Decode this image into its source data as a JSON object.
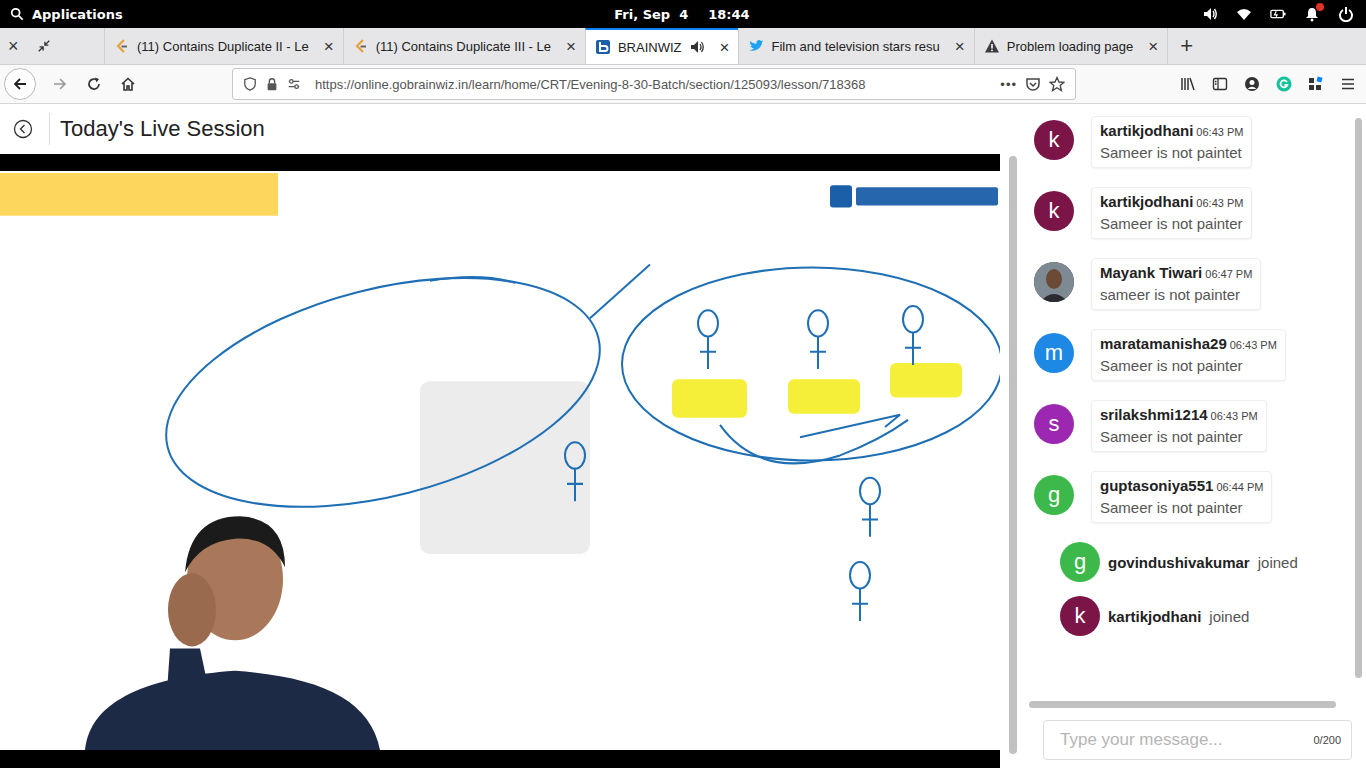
{
  "topbar": {
    "menu": "Applications",
    "date": "Fri, Sep  4",
    "time": "18:44",
    "notification": true
  },
  "window_controls": {
    "close": "×"
  },
  "tabs": [
    {
      "label": "(11) Contains Duplicate II - Le",
      "selected": false,
      "kind": "leetcode",
      "playing": false
    },
    {
      "label": "(11) Contains Duplicate III - Le",
      "selected": false,
      "kind": "leetcode",
      "playing": false
    },
    {
      "label": "BRAINWIZ",
      "selected": true,
      "kind": "brainwiz",
      "playing": true
    },
    {
      "label": "Film and television stars resu",
      "selected": false,
      "kind": "twitter",
      "playing": false
    },
    {
      "label": "Problem loading page",
      "selected": false,
      "kind": "warning",
      "playing": false
    }
  ],
  "tab_close": "×",
  "new_tab": "+",
  "address_bar": {
    "url": "https://online.gobrainwiz.in/learn/home/CRT/Evening-8-30-Batch/section/125093/lesson/718368",
    "page_actions": "•••",
    "bookmarked": false
  },
  "page": {
    "title": "Today's Live Session"
  },
  "chat": {
    "messages": [
      {
        "kind": "message",
        "name": "kartikjodhani",
        "time": "06:43 PM",
        "text": "Sameer is not paintet",
        "avatar": {
          "kind": "letter",
          "initial": "k",
          "color": "#7b1548"
        }
      },
      {
        "kind": "message",
        "name": "kartikjodhani",
        "time": "06:43 PM",
        "text": "Sameer is not painter",
        "avatar": {
          "kind": "letter",
          "initial": "k",
          "color": "#7b1548"
        }
      },
      {
        "kind": "message",
        "name": "Mayank Tiwari",
        "time": "06:47 PM",
        "text": "sameer is not painter",
        "avatar": {
          "kind": "photo",
          "color": "#5b4a3c"
        }
      },
      {
        "kind": "message",
        "name": "maratamanisha29",
        "time": "06:43 PM",
        "text": "Sameer is not painter",
        "avatar": {
          "kind": "letter",
          "initial": "m",
          "color": "#1e88e5"
        }
      },
      {
        "kind": "message",
        "name": "srilakshmi1214",
        "time": "06:43 PM",
        "text": "Sameer is not painter",
        "avatar": {
          "kind": "letter",
          "initial": "s",
          "color": "#9c27b0"
        }
      },
      {
        "kind": "message",
        "name": "guptasoniya551",
        "time": "06:44 PM",
        "text": "Sameer is not painter",
        "avatar": {
          "kind": "letter",
          "initial": "g",
          "color": "#3cb94a"
        }
      },
      {
        "kind": "joined",
        "name": "govindushivakumar",
        "status": "joined",
        "avatar": {
          "kind": "letter",
          "initial": "g",
          "color": "#3cb94a"
        }
      },
      {
        "kind": "joined",
        "name": "kartikjodhani",
        "status": "joined",
        "avatar": {
          "kind": "letter",
          "initial": "k",
          "color": "#7b1548"
        }
      }
    ],
    "input": {
      "placeholder": "Type your message...",
      "counter": "0/200"
    }
  }
}
